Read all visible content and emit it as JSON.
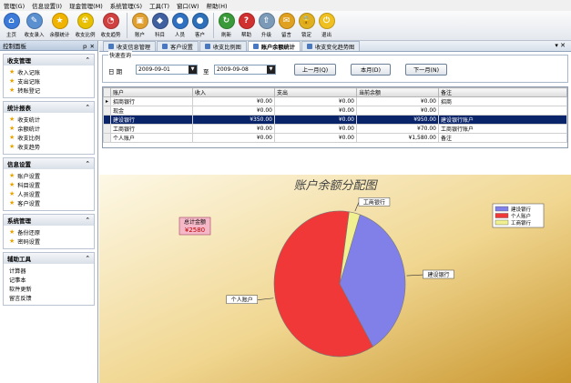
{
  "menu": [
    "管理(G)",
    "信息设置(I)",
    "现金管理(M)",
    "系统管理(S)",
    "工具(T)",
    "窗口(W)",
    "帮助(H)"
  ],
  "toolbar": [
    {
      "label": "主页",
      "icon": "home-icon",
      "color": "#3b7ad8",
      "glyph": "⌂"
    },
    {
      "label": "收支录入",
      "icon": "pen-icon",
      "color": "#5a8fd0",
      "glyph": "✎"
    },
    {
      "label": "余额统计",
      "icon": "star-icon",
      "color": "#f0b400",
      "glyph": "★"
    },
    {
      "label": "收支比例",
      "icon": "radiation-icon",
      "color": "#e8c000",
      "glyph": "☢"
    },
    {
      "label": "收支趋势",
      "icon": "chart-icon",
      "color": "#d04040",
      "glyph": "◔"
    },
    {
      "label": "账户",
      "icon": "account-icon",
      "color": "#e0a030",
      "glyph": "▣"
    },
    {
      "label": "科目",
      "icon": "subject-icon",
      "color": "#4060a0",
      "glyph": "◆"
    },
    {
      "label": "人员",
      "icon": "person-icon",
      "color": "#3070c0",
      "glyph": "●"
    },
    {
      "label": "客户",
      "icon": "customer-icon",
      "color": "#2d6fb8",
      "glyph": "●"
    },
    {
      "label": "刷新",
      "icon": "refresh-icon",
      "color": "#3a9a3a",
      "glyph": "↻"
    },
    {
      "label": "帮助",
      "icon": "help-icon",
      "color": "#d03030",
      "glyph": "?"
    },
    {
      "label": "升级",
      "icon": "upgrade-icon",
      "color": "#7a9ab8",
      "glyph": "⇧"
    },
    {
      "label": "留言",
      "icon": "message-icon",
      "color": "#e0a020",
      "glyph": "✉"
    },
    {
      "label": "锁定",
      "icon": "lock-icon",
      "color": "#e0b020",
      "glyph": "🔒"
    },
    {
      "label": "退出",
      "icon": "exit-icon",
      "color": "#f0c020",
      "glyph": "⏻"
    }
  ],
  "sidebar": {
    "title": "控制面板",
    "pin": "ｐ ✕",
    "sections": [
      {
        "title": "收支管理",
        "items": [
          "收入记账",
          "支出记账",
          "转账登记"
        ]
      },
      {
        "title": "统计报表",
        "items": [
          "收支统计",
          "余额统计",
          "收支比例",
          "收支趋势"
        ]
      },
      {
        "title": "信息设置",
        "items": [
          "账户设置",
          "科目设置",
          "人员设置",
          "客户设置"
        ]
      },
      {
        "title": "系统管理",
        "items": [
          "备份还原",
          "密码设置"
        ]
      },
      {
        "title": "辅助工具",
        "items": [
          "计算器",
          "记事本",
          "软件更新",
          "留言反馈"
        ]
      }
    ]
  },
  "tabs": [
    "收支信息管理",
    "客户设置",
    "收支比例图",
    "账户余额统计",
    "收支变化趋势图"
  ],
  "active_tab": 3,
  "query": {
    "legend": "快速查询",
    "date_label": "日 期",
    "from": "2009-09-01",
    "to_label": "至",
    "to": "2009-09-08",
    "prev_btn": "上一月(Q)",
    "this_btn": "本月(D)",
    "next_btn": "下一月(N)"
  },
  "table": {
    "headers": [
      "账户",
      "收入",
      "支出",
      "当前余额",
      "备注"
    ],
    "rows": [
      [
        "招商银行",
        "¥0.00",
        "¥0.00",
        "¥0.00",
        "招商"
      ],
      [
        "现金",
        "¥0.00",
        "¥0.00",
        "¥0.00",
        ""
      ],
      [
        "建设银行",
        "¥350.00",
        "¥0.00",
        "¥950.00",
        "建设银行账户"
      ],
      [
        "工商银行",
        "¥0.00",
        "¥0.00",
        "¥70.00",
        "工商银行账户"
      ],
      [
        "个人账户",
        "¥0.00",
        "¥0.00",
        "¥1,580.00",
        "备注"
      ]
    ],
    "selected_row": 2
  },
  "chart_data": {
    "type": "pie",
    "title": "账户余额分配图",
    "total_label": "总计金额",
    "total_value": "¥2580",
    "slices": [
      {
        "name": "建设银行",
        "value": 950,
        "color": "#8080e8"
      },
      {
        "name": "个人账户",
        "value": 1580,
        "color": "#f03838"
      },
      {
        "name": "工商银行",
        "value": 70,
        "color": "#f0f090"
      }
    ],
    "legend_position": "top-right"
  }
}
